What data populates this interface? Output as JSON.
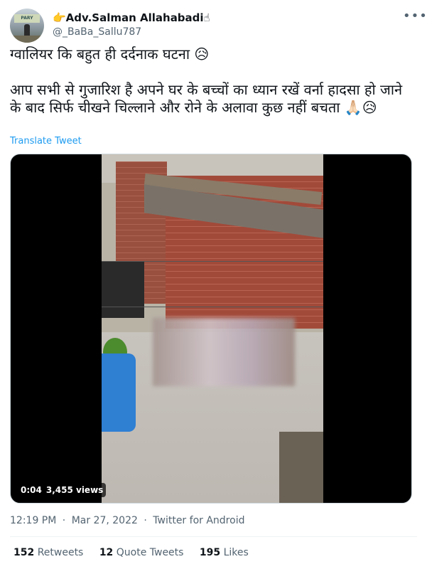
{
  "tweet": {
    "author_name": "👉Adv.Salman Allahabadi☝",
    "author_handle": "@_BaBa_Sallu787",
    "avatar_sign_text": "PARY",
    "more_icon": "more-icon",
    "text": "ग्वालियर कि बहुत ही दर्दनाक घटना 😥\n\nआप सभी से गुजारिश है अपने घर के बच्चों का ध्यान रखें वर्ना हादसा हो जाने के बाद सिर्फ चीखने चिल्लाने और रोने के अलावा कुछ नहीं बचता 🙏🏻😥",
    "translate_label": "Translate Tweet",
    "video": {
      "duration": "0:04",
      "views": "3,455 views"
    },
    "time": "12:19 PM",
    "date": "Mar 27, 2022",
    "source": "Twitter for Android",
    "separator": "·",
    "stats": {
      "retweets_count": "152",
      "retweets_label": "Retweets",
      "quotes_count": "12",
      "quotes_label": "Quote Tweets",
      "likes_count": "195",
      "likes_label": "Likes"
    }
  },
  "colors": {
    "link": "#1d9bf0",
    "secondary_text": "#536471",
    "primary_text": "#0f1419"
  }
}
